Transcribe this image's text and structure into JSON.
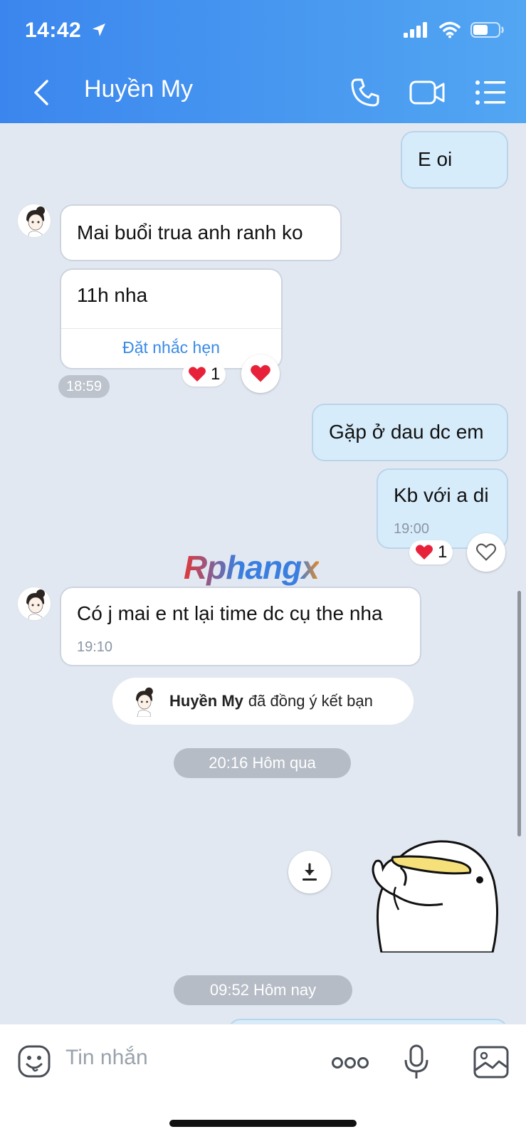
{
  "status_bar": {
    "time": "14:42"
  },
  "header": {
    "title": "Huyền My"
  },
  "messages": {
    "m1": {
      "text": "E oi"
    },
    "m2": {
      "text": "Mai buổi trua anh ranh ko"
    },
    "m3": {
      "text": "11h nha",
      "action": "Đặt nhắc hẹn",
      "reaction_count": "1",
      "time": "18:59"
    },
    "m4": {
      "text": "Gặp ở dau dc em"
    },
    "m5": {
      "text": "Kb với a di",
      "time": "19:00",
      "reaction_count": "1"
    },
    "m6": {
      "text": "Có j mai e nt lại time dc cụ the nha",
      "time": "19:10"
    }
  },
  "friend_accept": {
    "name": "Huyền My",
    "text": "đã đồng ý kết bạn"
  },
  "time_dividers": {
    "d1": "20:16 Hôm qua",
    "d2": "09:52 Hôm nay"
  },
  "watermark": {
    "text": "Rphangx"
  },
  "input": {
    "placeholder": "Tin nhắn"
  },
  "colors": {
    "header_start": "#3b86ee",
    "header_end": "#52a6f2",
    "link": "#3a8ae6",
    "heart": "#e8213a"
  },
  "icons": [
    "location-arrow-icon",
    "signal-icon",
    "wifi-icon",
    "battery-icon",
    "back-icon",
    "phone-icon",
    "video-icon",
    "menu-icon",
    "heart-icon",
    "download-icon",
    "emoji-icon",
    "more-icon",
    "microphone-icon",
    "image-icon"
  ]
}
